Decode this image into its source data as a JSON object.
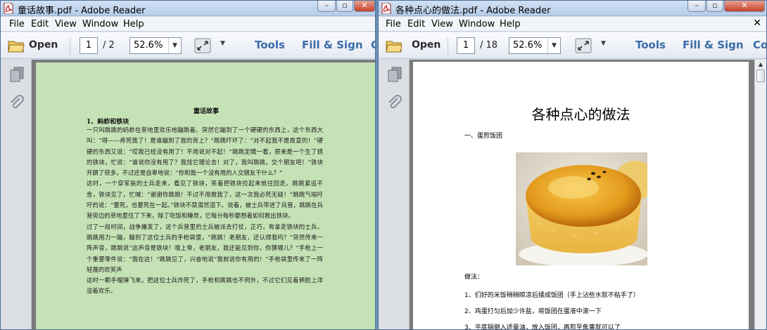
{
  "left_window": {
    "title": "童话故事.pdf - Adobe Reader",
    "menu": [
      "File",
      "Edit",
      "View",
      "Window",
      "Help"
    ],
    "toolbar": {
      "open_label": "Open",
      "page_current": "1",
      "page_total": "/ 2",
      "zoom": "52.6%",
      "tools_label": "Tools",
      "fill_sign_label": "Fill & Sign",
      "comment_label_partial": "C"
    },
    "document": {
      "title": "童话故事",
      "section": "1、蚂蚱和铁块",
      "paragraphs": [
        "一只叫跳跳的蚂蚱在草地里欢乐地蹦跳着。突然它蹦到了一个硬硬的东西上，这个东西大叫：“呀——疼死我了！是谁蹦到了我的背上？”跳跳吓坏了：“对不起我不是故意的！”硬硬的东西又说：“哎我已经没有用了！不用说对不起！”跳跳定睛一看，原来是一个生了锈的铁块，忙说：“谁说你没有用了？我找它理论去！对了，我叫跳跳，交个朋友吧！”铁块开朗了很多，不过还是自卑地说：“你和我一个没有用的人交朋友干什么？”",
        "这时，一个穿军装的士兵走来，看见了铁块，笑着把铁块捡起来就往回走。跳跳紧追不舍，铁块见了，忙喊：“谢谢你跳跳！不过不用救我了，这一次我必死无疑！”跳跳气喘吁吁的说：“要死，也要死在一起。”铁块不禁潸然泪下。说着，被士兵带进了兵营，跳跳在兵营旁边的草地里住了下来，除了吃饭和睡觉，它每分每秒都想着如何救出铁块。",
        "过了一段时间，战争爆发了，这个兵营里的士兵被派去打仗，正巧，有拿走铁块的士兵，跳跳用力一蹦，蹦到了这位士兵的手枪袋里，“跳跳！老朋友，还认得我吗？”突然传来一阵声音，跳跳说“这声音是铁块！哦上帝，老朋友，我还能见到你，你猜哪儿？”手枪上一个重要零件说：“我在这！”跳跳见了，兴奋地说“我就说你有用的！”手枪袋里传来了一阵轻蔑的欢笑声",
        "这时一颗手榴弹飞来，把这位士兵炸死了，手枪和跳跳也不例外，不过它们见着俩脸上洋溢着欢乐。"
      ]
    }
  },
  "right_window": {
    "title": "各种点心的做法.pdf - Adobe Reader",
    "menu": [
      "File",
      "Edit",
      "View",
      "Window",
      "Help"
    ],
    "toolbar": {
      "open_label": "Open",
      "page_current": "1",
      "page_total": "/ 18",
      "zoom": "52.6%",
      "tools_label": "Tools",
      "fill_sign_label": "Fill & Sign",
      "comment_label_partial": "Co"
    },
    "document": {
      "title": "各种点心的做法",
      "section": "一、蛋煎饭团",
      "method_label": "做法：",
      "steps": [
        "1、们好的米饭稍稍晾凉后揉成饭团（手上沾些水就不粘手了）",
        "2、鸡蛋打匀后加少许盐，将饭团在蛋液中滚一下",
        "3、平底锅倒入适量油，放入饭团，再煎至焦黄就可以了"
      ]
    }
  },
  "colors": {
    "green_page": "#c5e2b6",
    "link_blue": "#3a6ca8",
    "viewport_gray": "#7a7a7a"
  }
}
